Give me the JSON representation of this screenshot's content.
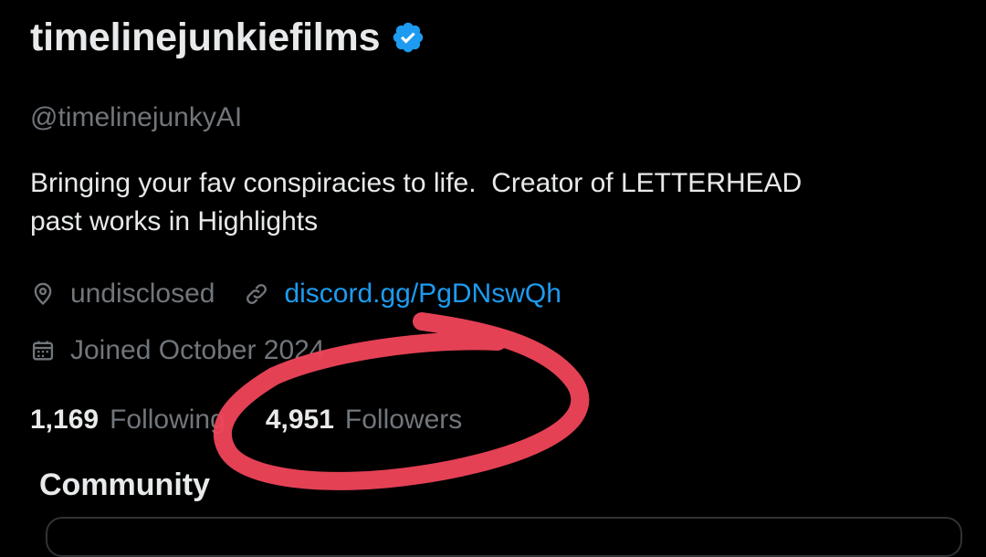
{
  "profile": {
    "display_name": "timelinejunkiefilms",
    "verified_icon": "verified-badge-icon",
    "handle": "@timelinejunkyAI",
    "bio_lines": [
      "Bringing your fav conspiracies to life.  Creator of LETTERHEAD",
      "past works in Highlights"
    ],
    "location": {
      "icon": "location-pin-icon",
      "text": "undisclosed"
    },
    "website": {
      "icon": "link-icon",
      "text": "discord.gg/PgDNswQh"
    },
    "joined": {
      "icon": "calendar-icon",
      "text": "Joined October 2024"
    },
    "stats": {
      "following_count": "1,169",
      "following_label": "Following",
      "followers_count": "4,951",
      "followers_label": "Followers"
    },
    "community_heading": "Community"
  },
  "colors": {
    "background": "#000000",
    "primary_text": "#e7e9ea",
    "secondary_text": "#71767b",
    "link": "#1d9bf0",
    "verified": "#1d9bf0",
    "annotation": "#f0445a"
  },
  "annotation": {
    "icon": "red-circle-scribble",
    "target": "followers-stat"
  }
}
